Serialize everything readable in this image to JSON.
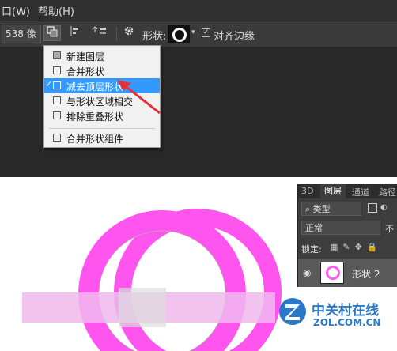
{
  "menu": {
    "window": "口(W)",
    "help": "帮助(H)"
  },
  "options": {
    "width_value": "538 像",
    "shape_label": "形状:",
    "align_edges_label": "对齐边缘",
    "align_edges_checked": true
  },
  "path_ops_menu": {
    "items": [
      {
        "label": "新建图层",
        "icon": "new-layer-icon"
      },
      {
        "label": "合并形状",
        "icon": "combine-shapes-icon"
      },
      {
        "label": "减去顶层形状",
        "icon": "subtract-front-shape-icon",
        "selected": true
      },
      {
        "label": "与形状区域相交",
        "icon": "intersect-shape-icon"
      },
      {
        "label": "排除重叠形状",
        "icon": "exclude-overlap-icon"
      },
      {
        "label": "合并形状组件",
        "icon": "merge-components-icon"
      }
    ]
  },
  "layers_panel": {
    "tabs": [
      "3D",
      "图层",
      "通道",
      "路径"
    ],
    "active_tab": "图层",
    "filter": "类型",
    "blend_mode": "正常",
    "opacity_label": "不",
    "lock_label": "锁定:",
    "layer_name": "形状 2"
  },
  "watermark": {
    "name": "中关村在线",
    "url": "ZOL.COM.CN"
  },
  "colors": {
    "shape_fill": "#ff55ee",
    "menu_highlight": "#3399ff",
    "annotation_arrow": "#e8303a"
  }
}
